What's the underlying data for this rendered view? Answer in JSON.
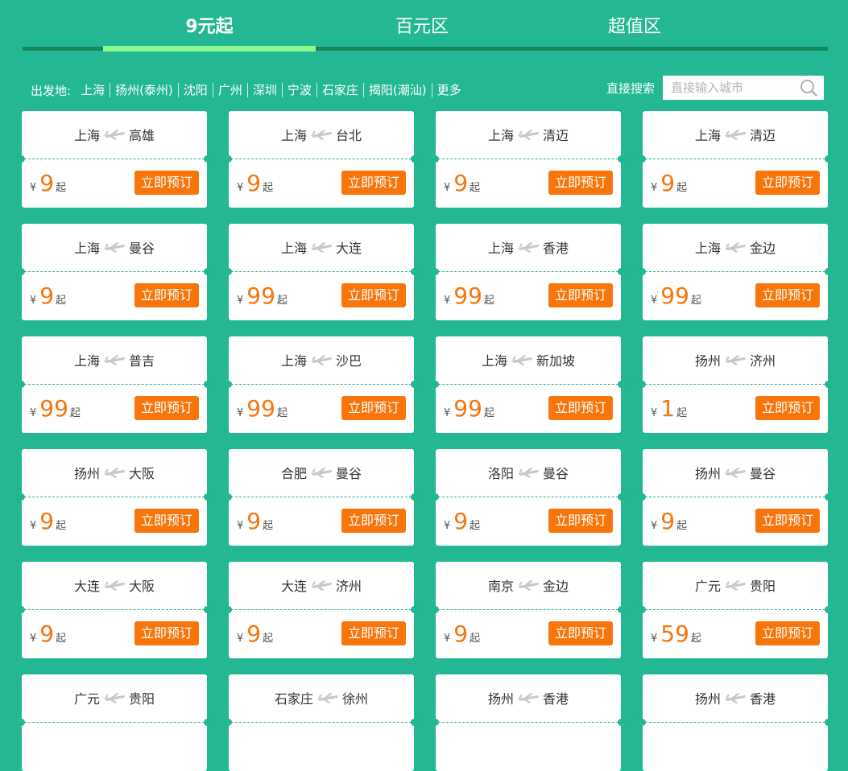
{
  "tabs": [
    {
      "label": "9元起",
      "active": true
    },
    {
      "label": "百元区",
      "active": false
    },
    {
      "label": "超值区",
      "active": false
    }
  ],
  "filter": {
    "label": "出发地:",
    "cities": [
      "上海",
      "扬州(泰州)",
      "沈阳",
      "广州",
      "深圳",
      "宁波",
      "石家庄",
      "揭阳(潮汕)",
      "更多"
    ]
  },
  "search": {
    "label": "直接搜索",
    "placeholder": "直接输入城市",
    "icon": "search-icon"
  },
  "card_common": {
    "currency": "¥",
    "suffix": "起",
    "button_label": "立即预订"
  },
  "colors": {
    "background": "#23b793",
    "accent": "#f8750b",
    "tab_indicator": "#8bf98b"
  },
  "routes": [
    {
      "from": "上海",
      "to": "高雄",
      "price": "9"
    },
    {
      "from": "上海",
      "to": "台北",
      "price": "9"
    },
    {
      "from": "上海",
      "to": "清迈",
      "price": "9"
    },
    {
      "from": "上海",
      "to": "清迈",
      "price": "9"
    },
    {
      "from": "上海",
      "to": "曼谷",
      "price": "9"
    },
    {
      "from": "上海",
      "to": "大连",
      "price": "99"
    },
    {
      "from": "上海",
      "to": "香港",
      "price": "99"
    },
    {
      "from": "上海",
      "to": "金边",
      "price": "99"
    },
    {
      "from": "上海",
      "to": "普吉",
      "price": "99"
    },
    {
      "from": "上海",
      "to": "沙巴",
      "price": "99"
    },
    {
      "from": "上海",
      "to": "新加坡",
      "price": "99"
    },
    {
      "from": "扬州",
      "to": "济州",
      "price": "1"
    },
    {
      "from": "扬州",
      "to": "大阪",
      "price": "9"
    },
    {
      "from": "合肥",
      "to": "曼谷",
      "price": "9"
    },
    {
      "from": "洛阳",
      "to": "曼谷",
      "price": "9"
    },
    {
      "from": "扬州",
      "to": "曼谷",
      "price": "9"
    },
    {
      "from": "大连",
      "to": "大阪",
      "price": "9"
    },
    {
      "from": "大连",
      "to": "济州",
      "price": "9"
    },
    {
      "from": "南京",
      "to": "金边",
      "price": "9"
    },
    {
      "from": "广元",
      "to": "贵阳",
      "price": "59"
    },
    {
      "from": "广元",
      "to": "贵阳",
      "price": ""
    },
    {
      "from": "石家庄",
      "to": "徐州",
      "price": ""
    },
    {
      "from": "扬州",
      "to": "香港",
      "price": ""
    },
    {
      "from": "扬州",
      "to": "香港",
      "price": ""
    }
  ]
}
